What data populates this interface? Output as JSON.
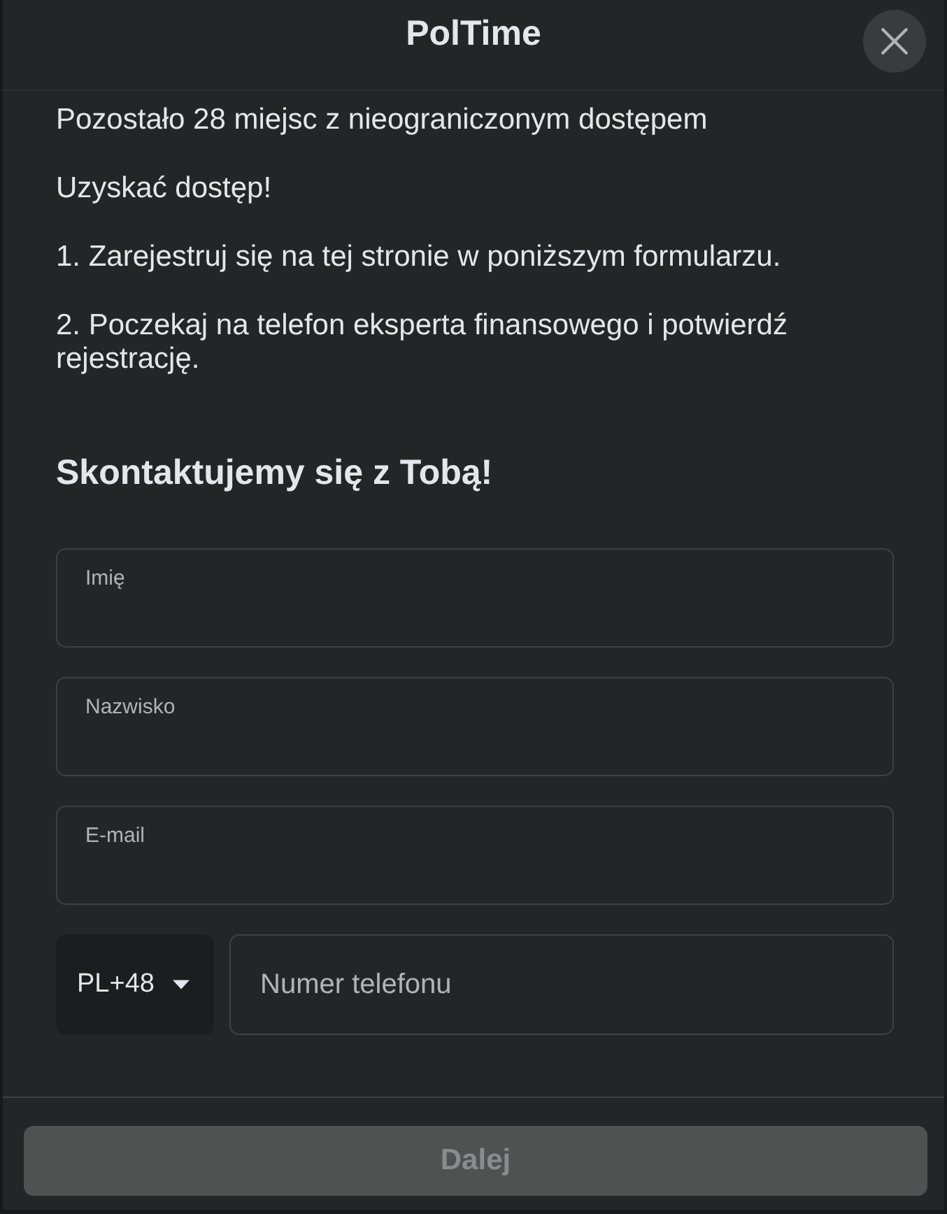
{
  "dialog": {
    "title": "PolTime"
  },
  "paragraphs": [
    "Pozostało 28 miejsc z nieograniczonym dostępem",
    "Uzyskać dostęp!",
    "1. Zarejestruj się na tej stronie w poniższym formularzu.",
    "2. Poczekaj na telefon eksperta finansowego i potwierdź rejestrację."
  ],
  "form": {
    "heading": "Skontaktujemy się z Tobą!",
    "fields": [
      {
        "label": "Imię"
      },
      {
        "label": "Nazwisko"
      },
      {
        "label": "E-mail"
      }
    ],
    "phone": {
      "country_code": "PL+48",
      "placeholder": "Numer telefonu"
    }
  },
  "submit": {
    "label": "Dalej",
    "disabled": true
  }
}
